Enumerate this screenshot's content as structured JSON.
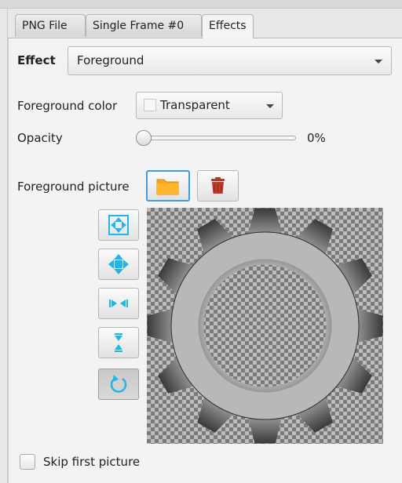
{
  "tabs": [
    {
      "label": "PNG File",
      "active": false
    },
    {
      "label": "Single Frame #0",
      "active": false
    },
    {
      "label": "Effects",
      "active": true
    }
  ],
  "effect": {
    "label": "Effect",
    "selected": "Foreground"
  },
  "foreground_color": {
    "label": "Foreground color",
    "selected": "Transparent"
  },
  "opacity": {
    "label": "Opacity",
    "value_text": "0%",
    "value": 0
  },
  "foreground_picture": {
    "label": "Foreground picture"
  },
  "toolbar_icons": [
    {
      "name": "open-folder-icon"
    },
    {
      "name": "trash-icon"
    },
    {
      "name": "fit-both-icon"
    },
    {
      "name": "fit-all-directions-icon"
    },
    {
      "name": "fit-horizontal-icon"
    },
    {
      "name": "fit-vertical-icon"
    },
    {
      "name": "reset-icon"
    }
  ],
  "skip_first": {
    "label": "Skip first picture",
    "checked": false
  },
  "colors": {
    "accent_blue": "#3f9be2",
    "folder_orange": "#f5a623",
    "trash_red": "#c0392b",
    "cyan_icon": "#1fb6e8",
    "preview_checker_dark": "#7a7a7a",
    "preview_checker_light": "#bdbdbd"
  }
}
